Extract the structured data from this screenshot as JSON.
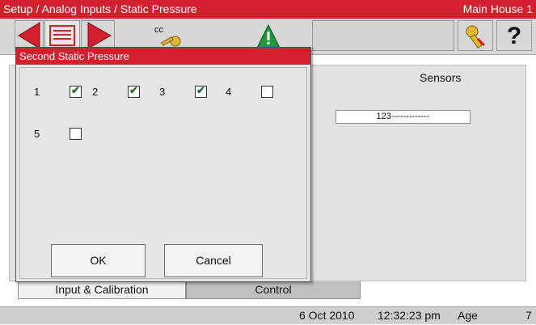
{
  "titlebar": {
    "path": "Setup / Analog Inputs / Static Pressure",
    "location": "Main House 1"
  },
  "toolbar": {
    "icons": [
      "arrow-left-icon",
      "list-icon",
      "arrow-right-icon",
      "key-cc-icon",
      "alarm-warning-icon",
      "key-icon",
      "help-icon"
    ],
    "cc_label": "cc",
    "help_label": "?"
  },
  "main": {
    "sensors_title": "Sensors",
    "sensor_value": "123-------------"
  },
  "tabs": [
    {
      "label": "Input & Calibration",
      "active": true
    },
    {
      "label": "Control",
      "active": false
    }
  ],
  "status": {
    "date": "6 Oct 2010",
    "time": "12:32:23 pm",
    "age_label": "Age",
    "age_value": "7"
  },
  "dialog": {
    "title": "Second Static Pressure",
    "checkboxes": [
      {
        "label": "1",
        "checked": true
      },
      {
        "label": "2",
        "checked": true
      },
      {
        "label": "3",
        "checked": true
      },
      {
        "label": "4",
        "checked": false
      },
      {
        "label": "5",
        "checked": false
      }
    ],
    "ok_label": "OK",
    "cancel_label": "Cancel"
  },
  "colors": {
    "accent_red": "#d2202e",
    "check_green": "#1f6b2a",
    "warning_green": "#1e9a3a"
  }
}
